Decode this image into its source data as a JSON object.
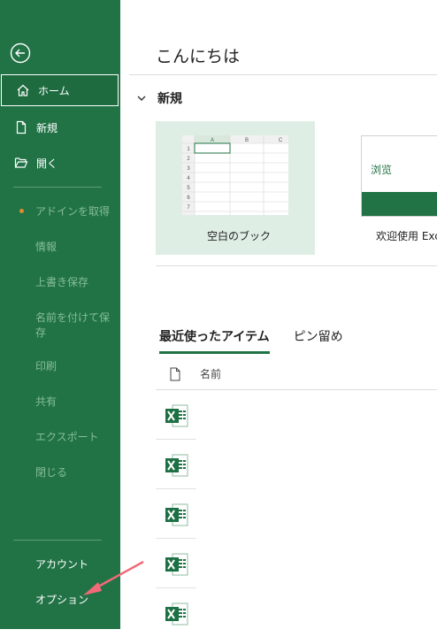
{
  "sidebar": {
    "back_icon": "arrow-left-circle-icon",
    "home": {
      "label": "ホーム",
      "icon": "home-icon"
    },
    "new": {
      "label": "新規",
      "icon": "document-icon"
    },
    "open": {
      "label": "開く",
      "icon": "folder-open-icon"
    },
    "disabled_items": [
      "アドインを取得",
      "情報",
      "上書き保存",
      "名前を付けて保存",
      "印刷",
      "共有",
      "エクスポート",
      "閉じる"
    ],
    "account": "アカウント",
    "options": "オプション",
    "accent_color": "#217346",
    "dot_color": "#e08a29"
  },
  "main": {
    "greeting": "こんにちは",
    "new_section": "新規",
    "blank_workbook": "空白のブック",
    "welcome_tile": "欢迎使用 Exc",
    "tour_text": "浏览",
    "sheet_columns": [
      "A",
      "B",
      "C"
    ],
    "sheet_rows": [
      "1",
      "2",
      "3",
      "4",
      "5",
      "6",
      "7"
    ],
    "tabs": {
      "recent": "最近使ったアイテム",
      "pinned": "ピン留め"
    },
    "name_header": "名前",
    "file_icon": "excel-file-icon"
  }
}
